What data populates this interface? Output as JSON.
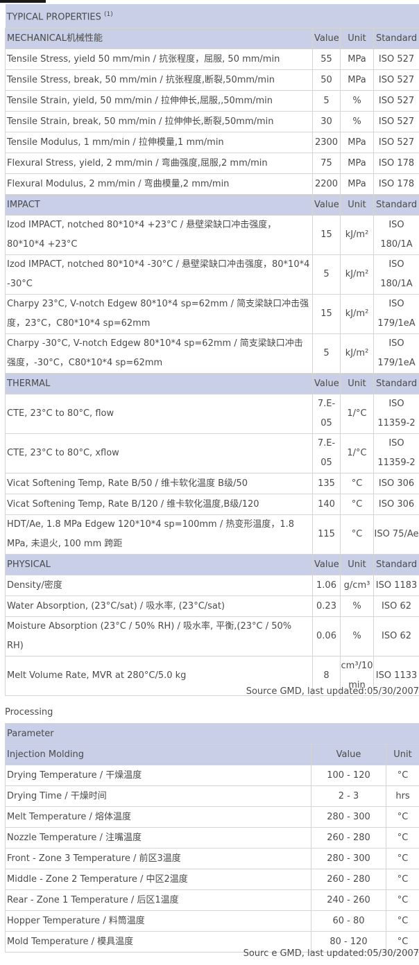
{
  "properties_table": {
    "title": "TYPICAL PROPERTIES",
    "title_footnote": "(1)",
    "column_headers": {
      "value": "Value",
      "unit": "Unit",
      "standard": "Standard"
    },
    "sections": [
      {
        "name": "MECHANICAL机械性能",
        "rows": [
          {
            "property": "Tensile Stress, yield 50 mm/min / 抗张程度，屈服, 50 mm/min",
            "value": "55",
            "unit": "MPa",
            "standard": "ISO 527"
          },
          {
            "property": "Tensile Stress, break, 50 mm/min / 抗张程度,断裂,50mm/min",
            "value": "50",
            "unit": "MPa",
            "standard": "ISO 527"
          },
          {
            "property": "Tensile Strain, yield, 50 mm/min / 拉伸伸长,屈服,,50mm/min",
            "value": "5",
            "unit": "%",
            "standard": "ISO 527"
          },
          {
            "property": "Tensile Strain, break, 50 mm/min / 拉伸伸长,断裂,50mm/min",
            "value": "30",
            "unit": "%",
            "standard": "ISO 527"
          },
          {
            "property": "Tensile Modulus, 1 mm/min / 拉伸模量,1 mm/min",
            "value": "2300",
            "unit": "MPa",
            "standard": "ISO 527"
          },
          {
            "property": "Flexural Stress, yield, 2 mm/min / 弯曲强度,屈服,2 mm/min",
            "value": "75",
            "unit": "MPa",
            "standard": "ISO 178"
          },
          {
            "property": "Flexural Modulus, 2 mm/min / 弯曲模量,2 mm/min",
            "value": "2200",
            "unit": "MPa",
            "standard": "ISO 178"
          }
        ]
      },
      {
        "name": "IMPACT",
        "rows": [
          {
            "property": "Izod IMPACT, notched 80*10*4 +23°C / 悬壁梁缺口冲击强度，80*10*4 +23°C",
            "value": "15",
            "unit": "kJ/m²",
            "standard": "ISO 180/1A"
          },
          {
            "property": "Izod IMPACT, notched 80*10*4 -30°C / 悬壁梁缺口冲击强度，80*10*4 -30°C",
            "value": "5",
            "unit": "kJ/m²",
            "standard": "ISO 180/1A"
          },
          {
            "property": "Charpy 23°C, V-notch Edgew 80*10*4 sp=62mm / 简支梁缺口冲击强度，23°C，C80*10*4 sp=62mm",
            "value": "15",
            "unit": "kJ/m²",
            "standard": "ISO 179/1eA"
          },
          {
            "property": "Charpy -30°C, V-notch Edgew 80*10*4 sp=62mm / 简支梁缺口冲击强度，-30°C，C80*10*4 sp=62mm",
            "value": "5",
            "unit": "kJ/m²",
            "standard": "ISO 179/1eA"
          }
        ]
      },
      {
        "name": "THERMAL",
        "rows": [
          {
            "property": "CTE, 23°C to 80°C, flow",
            "value": "7.E-05",
            "unit": "1/°C",
            "standard": "ISO 11359-2"
          },
          {
            "property": "CTE, 23°C to 80°C, xflow",
            "value": "7.E-05",
            "unit": "1/°C",
            "standard": "ISO 11359-2"
          },
          {
            "property": "Vicat Softening Temp, Rate B/50 / 维卡软化温度 B级/50",
            "value": "135",
            "unit": "°C",
            "standard": "ISO 306"
          },
          {
            "property": "Vicat Softening Temp, Rate B/120 / 维卡软化温度,B级/120",
            "value": "140",
            "unit": "°C",
            "standard": "ISO 306"
          },
          {
            "property": "HDT/Ae, 1.8 MPa Edgew 120*10*4 sp=100mm / 热变形温度，1.8 MPa, 未退火, 100 mm 跨距",
            "value": "115",
            "unit": "°C",
            "standard": "ISO 75/Ae"
          }
        ]
      },
      {
        "name": "PHYSICAL",
        "rows": [
          {
            "property": "Density/密度",
            "value": "1.06",
            "unit": "g/cm³",
            "standard": "ISO 1183"
          },
          {
            "property": "Water Absorption, (23°C/sat) / 吸水率, (23°C/sat)",
            "value": "0.23",
            "unit": "%",
            "standard": "ISO 62"
          },
          {
            "property": "Moisture Absorption (23°C / 50% RH) / 吸水率, 平衡,(23°C / 50% RH)",
            "value": "0.06",
            "unit": "%",
            "standard": "ISO 62"
          },
          {
            "property": "Melt Volume Rate, MVR at 280°C/5.0 kg",
            "value": "8",
            "unit": "cm³/10 min",
            "standard": "ISO 1133"
          }
        ]
      }
    ],
    "source_note": "Source GMD, last updated:05/30/2007"
  },
  "processing": {
    "heading": "Processing",
    "parameter_label": "Parameter",
    "section_name": "Injection Molding",
    "column_headers": {
      "value": "Value",
      "unit": "Unit"
    },
    "rows": [
      {
        "parameter": "Drying Temperature / 干燥温度",
        "value": "100 - 120",
        "unit": "°C"
      },
      {
        "parameter": "Drying Time / 干燥时间",
        "value": "2 - 3",
        "unit": "hrs"
      },
      {
        "parameter": "Melt Temperature / 熔体温度",
        "value": "280 - 300",
        "unit": "°C"
      },
      {
        "parameter": "Nozzle Temperature / 注嘴温度",
        "value": "260 - 280",
        "unit": "°C"
      },
      {
        "parameter": "Front - Zone 3 Temperature / 前区3温度",
        "value": "280 - 300",
        "unit": "°C"
      },
      {
        "parameter": "Middle - Zone 2 Temperature / 中区2温度",
        "value": "260 - 280",
        "unit": "°C"
      },
      {
        "parameter": "Rear - Zone 1 Temperature / 后区1温度",
        "value": "240 - 260",
        "unit": "°C"
      },
      {
        "parameter": "Hopper Temperature / 料筒温度",
        "value": "60 - 80",
        "unit": "°C"
      },
      {
        "parameter": "Mold Temperature / 模具温度",
        "value": "80 - 120",
        "unit": "°C"
      }
    ],
    "source_note": "Sourc e GMD, last updated:05/30/2007"
  }
}
